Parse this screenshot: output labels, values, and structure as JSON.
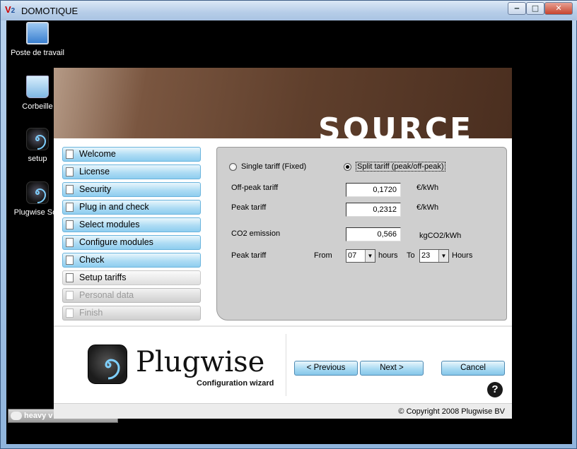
{
  "window": {
    "title": "DOMOTIQUE",
    "app_icon_letters": "V",
    "app_icon_sub": "2",
    "minimize_glyph": "‒",
    "maximize_glyph": "□",
    "close_glyph": "✕"
  },
  "desktop": {
    "icons": [
      {
        "label": "Poste de travail",
        "icon": "computer-icon"
      },
      {
        "label": "Corbeille",
        "icon": "recycle-bin-icon"
      },
      {
        "label": "setup",
        "icon": "plugwise-spiral-icon"
      },
      {
        "label": "Plugwise Sou",
        "icon": "plugwise-shortcut-icon"
      }
    ],
    "taskbar_item": "heavy v"
  },
  "installer": {
    "banner_text": "SOURCE",
    "nav": [
      {
        "label": "Welcome",
        "state": "done"
      },
      {
        "label": "License",
        "state": "done"
      },
      {
        "label": "Security",
        "state": "done"
      },
      {
        "label": "Plug in and check",
        "state": "done"
      },
      {
        "label": "Select modules",
        "state": "done"
      },
      {
        "label": "Configure modules",
        "state": "done"
      },
      {
        "label": "Check",
        "state": "done"
      },
      {
        "label": "Setup tariffs",
        "state": "current"
      },
      {
        "label": "Personal data",
        "state": "disabled"
      },
      {
        "label": "Finish",
        "state": "disabled"
      }
    ],
    "tariffs": {
      "single_label": "Single tariff (Fixed)",
      "split_label": "Split tariff (peak/off-peak)",
      "selected": "split",
      "offpeak_label": "Off-peak tariff",
      "offpeak_value": "0,1720",
      "offpeak_unit": "€/kWh",
      "peak_label": "Peak tariff",
      "peak_value": "0,2312",
      "peak_unit": "€/kWh",
      "co2_label": "CO2 emission",
      "co2_value": "0,566",
      "co2_unit": "kgCO2/kWh",
      "peak_hours_label": "Peak tariff",
      "from_label": "From",
      "from_value": "07",
      "hours_label": "hours",
      "to_label": "To",
      "to_value": "23",
      "hours_label_2": "Hours"
    },
    "logo_name": "Plugwise",
    "logo_subtitle": "Configuration wizard",
    "buttons": {
      "previous": "< Previous",
      "next": "Next >",
      "cancel": "Cancel"
    },
    "help_glyph": "?",
    "copyright": "© Copyright 2008 Plugwise BV"
  }
}
